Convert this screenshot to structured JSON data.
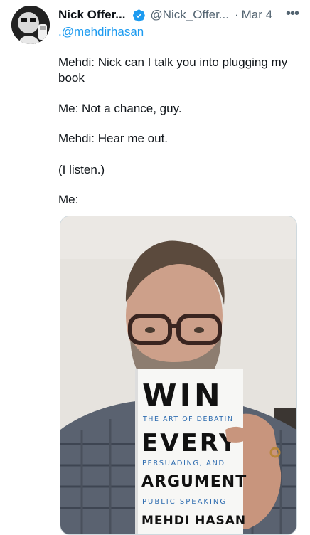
{
  "author": {
    "display_name": "Nick Offer...",
    "handle": "@Nick_Offer...",
    "date": "Mar 4",
    "separator": "·",
    "more_glyph": "•••"
  },
  "reply_to": ".@mehdirhasan",
  "tweet_lines": [
    "Mehdi: Nick can I talk you into plugging my",
    "book",
    "Me: Not a chance, guy.",
    "Mehdi: Hear me out.",
    "(I listen.)",
    "Me:"
  ],
  "book": {
    "title_1": "WIN",
    "subtitle_1": "THE ART OF DEBATIN",
    "title_2": "EVERY",
    "subtitle_2": "PERSUADING, AND",
    "title_3": "ARGUMENT",
    "subtitle_3": "PUBLIC SPEAKING",
    "author": "MEHDI HASAN"
  },
  "colors": {
    "accent": "#1d9bf0",
    "text": "#0f1419",
    "muted": "#536471",
    "book_blue": "#2f6db0",
    "book_black": "#111111"
  },
  "icons": {
    "verified": "verified-badge-icon",
    "more": "more-options-icon"
  }
}
